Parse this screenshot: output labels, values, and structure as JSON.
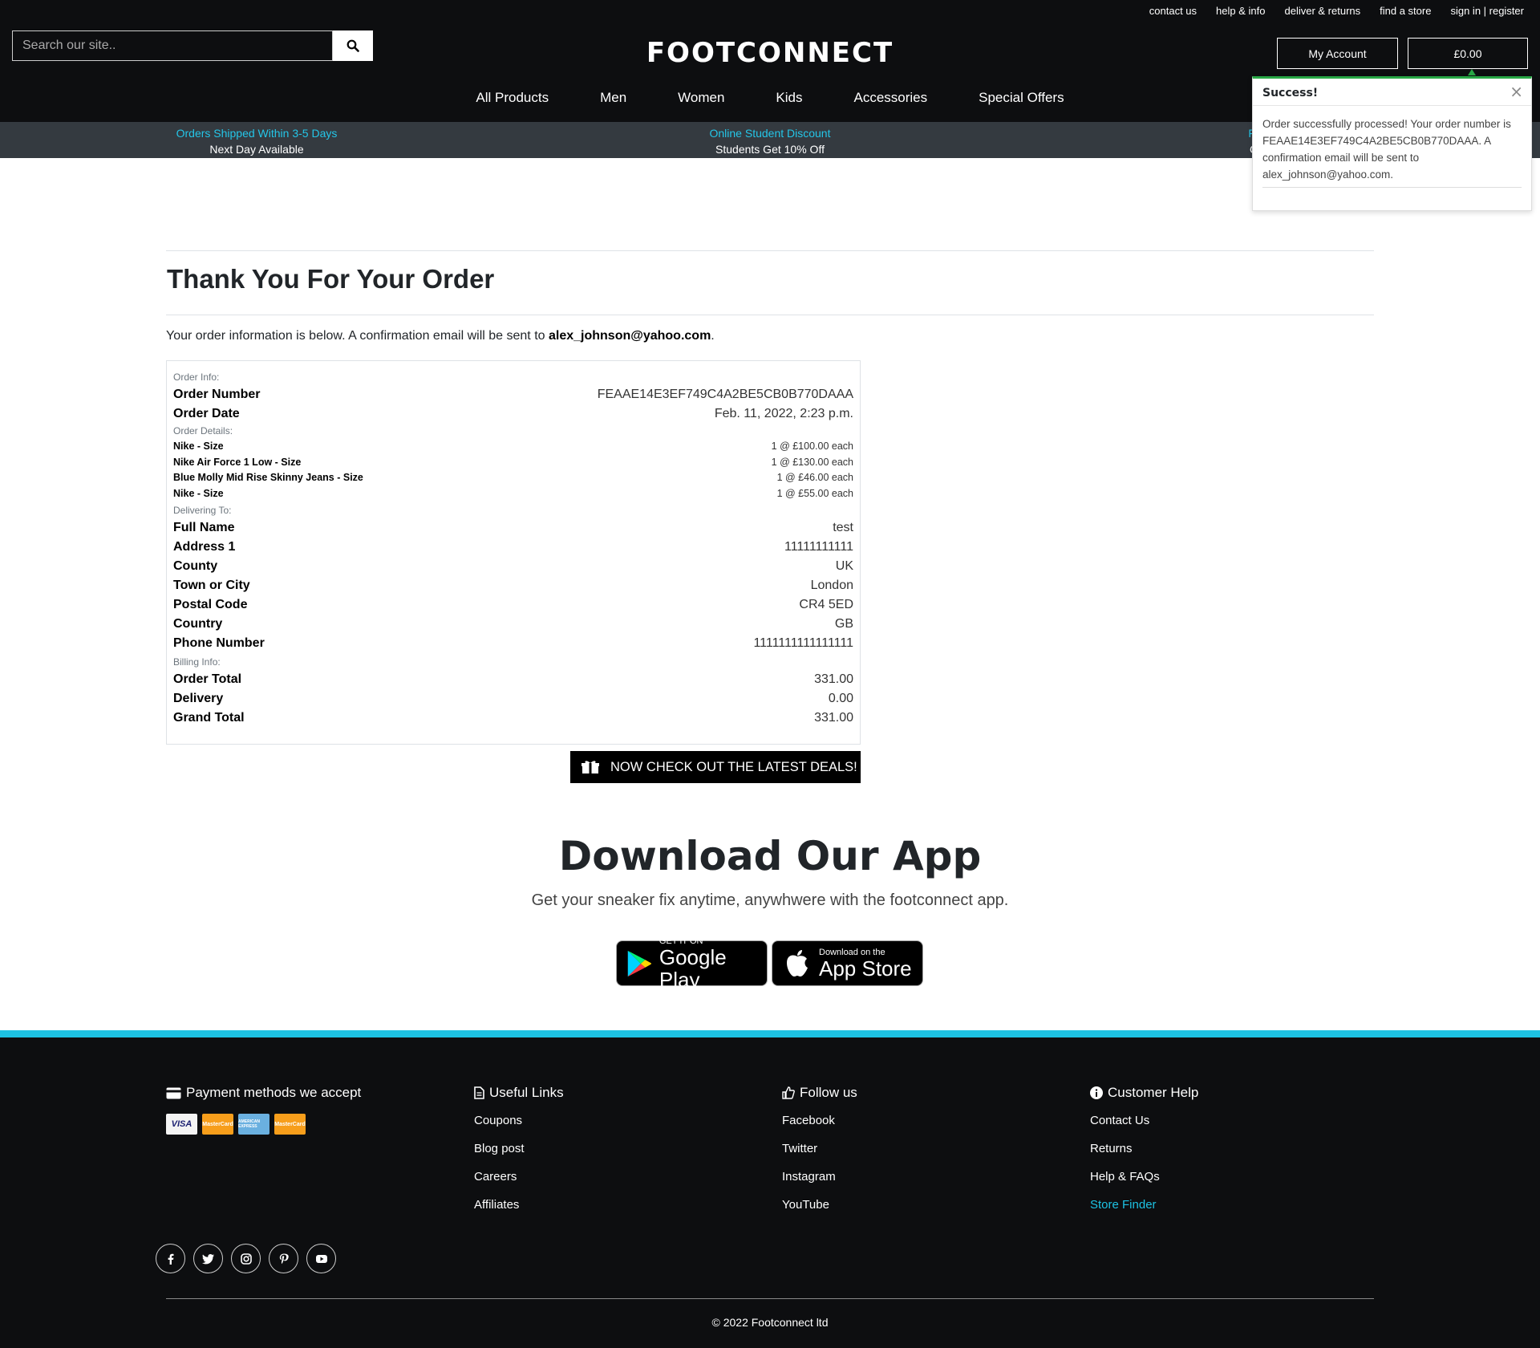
{
  "colors": {
    "header_bg": "#0d0e10",
    "accent_cyan": "#1dc2e3",
    "success_green": "#28a745",
    "promo_bg": "#343a40"
  },
  "header": {
    "top_links": [
      "contact us",
      "help & info",
      "deliver & returns",
      "find a store",
      "sign in | register"
    ],
    "search_placeholder": "Search our site..",
    "logo": "FOOTCONNECT",
    "my_account": "My Account",
    "cart_total": "£0.00",
    "nav": [
      "All Products",
      "Men",
      "Women",
      "Kids",
      "Accessories",
      "Special Offers"
    ]
  },
  "promo": [
    {
      "line1": "Orders Shipped Within 3-5 Days",
      "line2": "Next Day Available"
    },
    {
      "line1": "Online Student Discount",
      "line2": "Students Get 10% Off"
    },
    {
      "line1": "Free Shipping",
      "line2": "On All Orders"
    }
  ],
  "toast": {
    "title": "Success!",
    "close": "×",
    "message": "Order successfully processed! Your order number is FEAAE14E3EF749C4A2BE5CB0B770DAAA. A confirmation email will be sent to alex_johnson@yahoo.com."
  },
  "page": {
    "title": "Thank You For Your Order",
    "intro_prefix": "Your order information is below. A confirmation email will be sent to ",
    "intro_email": "alex_johnson@yahoo.com",
    "intro_suffix": "."
  },
  "order": {
    "order_info_label": "Order Info:",
    "order_info": [
      {
        "k": "Order Number",
        "v": "FEAAE14E3EF749C4A2BE5CB0B770DAAA"
      },
      {
        "k": "Order Date",
        "v": "Feb. 11, 2022, 2:23 p.m."
      }
    ],
    "details_label": "Order Details:",
    "details": [
      {
        "k": "Nike - Size",
        "v": "1 @ £100.00 each"
      },
      {
        "k": "Nike Air Force 1 Low - Size",
        "v": "1 @ £130.00 each"
      },
      {
        "k": "Blue Molly Mid Rise Skinny Jeans - Size",
        "v": "1 @ £46.00 each"
      },
      {
        "k": "Nike - Size",
        "v": "1 @ £55.00 each"
      }
    ],
    "delivering_label": "Delivering To:",
    "delivering": [
      {
        "k": "Full Name",
        "v": "test"
      },
      {
        "k": "Address 1",
        "v": "11111111111"
      },
      {
        "k": "County",
        "v": "UK"
      },
      {
        "k": "Town or City",
        "v": "London"
      },
      {
        "k": "Postal Code",
        "v": "CR4 5ED"
      },
      {
        "k": "Country",
        "v": "GB"
      },
      {
        "k": "Phone Number",
        "v": "1111111111111111"
      }
    ],
    "billing_label": "Billing Info:",
    "billing": [
      {
        "k": "Order Total",
        "v": "331.00"
      },
      {
        "k": "Delivery",
        "v": "0.00"
      },
      {
        "k": "Grand Total",
        "v": "331.00"
      }
    ]
  },
  "deals_button": "NOW CHECK OUT THE LATEST DEALS!",
  "app": {
    "title": "Download Our App",
    "subtitle": "Get your sneaker fix anytime, anywhwere with the footconnect app.",
    "google_small": "GET IT ON",
    "google_big": "Google Play",
    "apple_small": "Download on the",
    "apple_big": "App Store"
  },
  "footer": {
    "payment_title": "Payment methods we accept",
    "cards": [
      "VISA",
      "MasterCard",
      "AMERICAN EXPRESS",
      "MasterCard"
    ],
    "useful_title": "Useful Links",
    "useful_links": [
      "Coupons",
      "Blog post",
      "Careers",
      "Affiliates"
    ],
    "follow_title": "Follow us",
    "follow_links": [
      "Facebook",
      "Twitter",
      "Instagram",
      "YouTube"
    ],
    "help_title": "Customer Help",
    "help_links": [
      "Contact Us",
      "Returns",
      "Help & FAQs",
      "Store Finder"
    ],
    "social_icons": [
      "facebook-icon",
      "twitter-icon",
      "instagram-icon",
      "pinterest-icon",
      "youtube-icon"
    ],
    "copyright": "© 2022 Footconnect ltd"
  }
}
